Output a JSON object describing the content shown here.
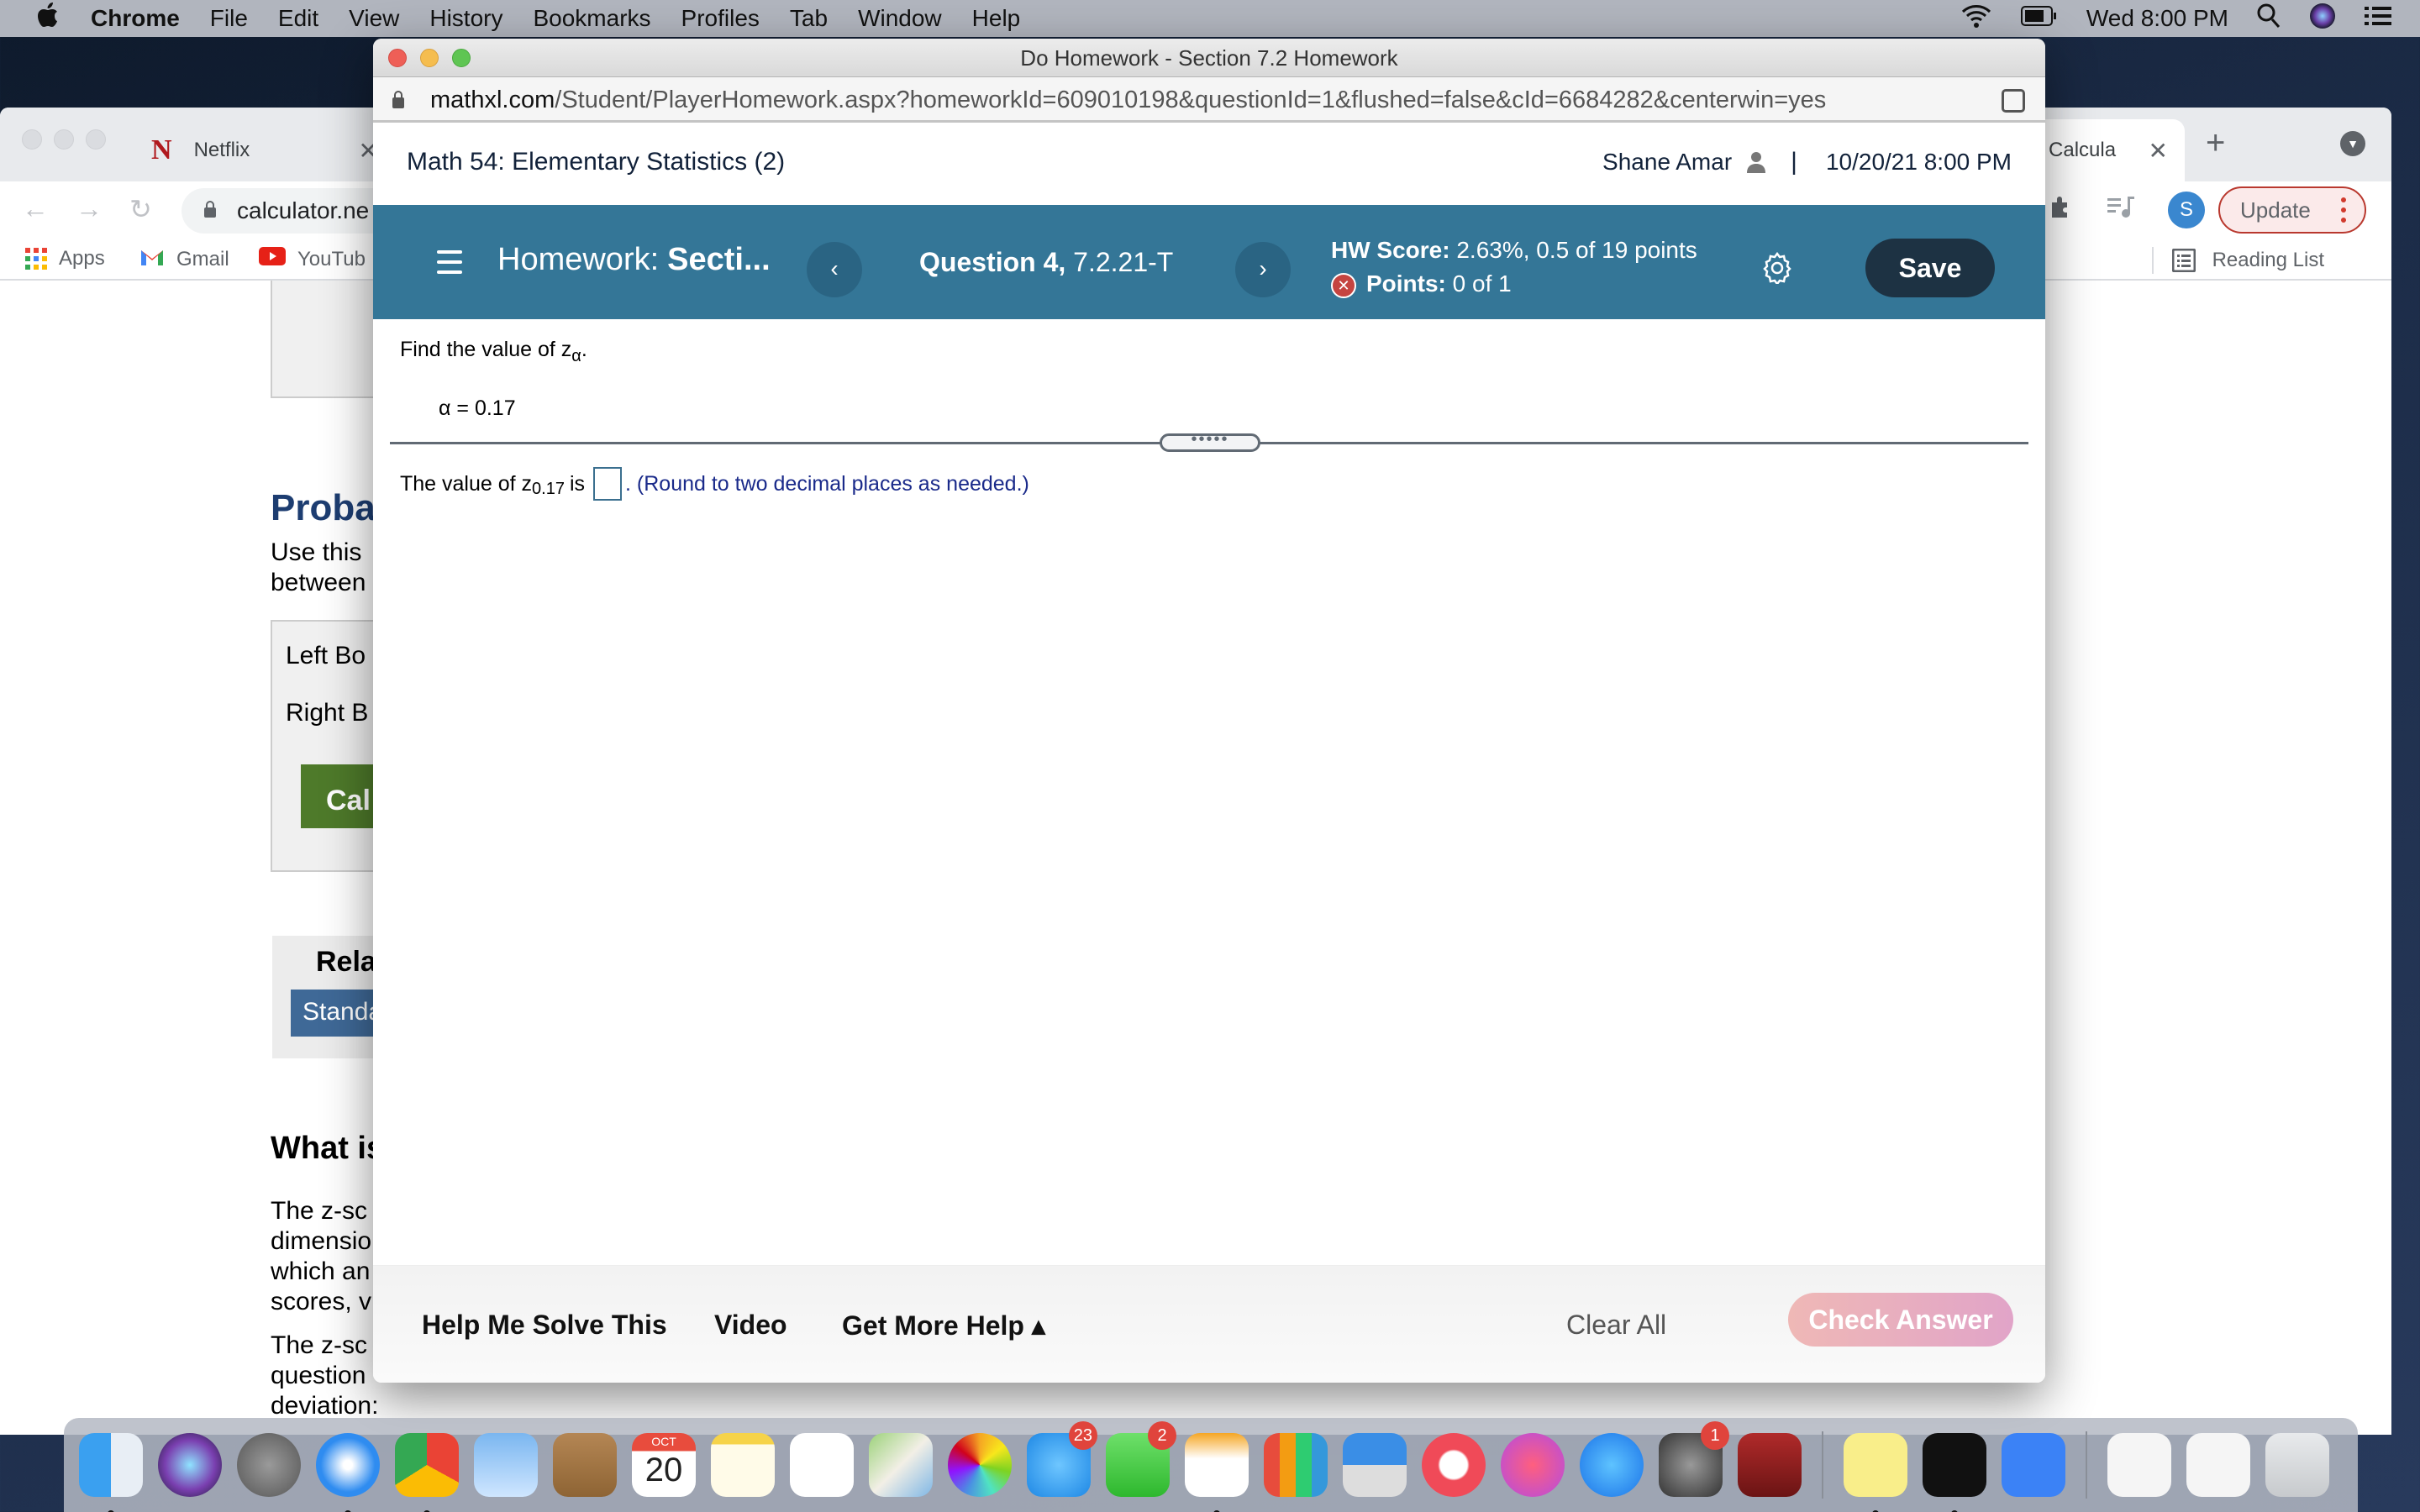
{
  "menubar": {
    "apple_icon": "apple-logo",
    "items": [
      "Chrome",
      "File",
      "Edit",
      "View",
      "History",
      "Bookmarks",
      "Profiles",
      "Tab",
      "Window",
      "Help"
    ],
    "clock": "Wed 8:00 PM",
    "status_icons": [
      "wifi-icon",
      "battery-icon",
      "spotlight-search-icon",
      "siri-icon",
      "control-center-icon"
    ]
  },
  "bg_browser": {
    "tabs": [
      {
        "label": "Netflix",
        "icon": "netflix-icon"
      },
      {
        "label": "re Calcula",
        "active": true
      }
    ],
    "new_tab_label": "+",
    "address": "calculator.ne",
    "avatar_letter": "S",
    "update_label": "Update",
    "bookmarks": [
      {
        "label": "Apps",
        "icon": "apps-grid-icon"
      },
      {
        "label": "Gmail",
        "icon": "gmail-icon"
      },
      {
        "label": "YouTub",
        "icon": "youtube-icon"
      }
    ],
    "reading_list": "Reading List",
    "page": {
      "heading_proba": "Proba",
      "use_this": [
        "Use this",
        "between"
      ],
      "left_bound": "Left Bo",
      "right_bound": "Right B",
      "calc_button": "Cal",
      "related": "Rela",
      "standard_link": "Standa",
      "what_is": "What is",
      "para1": [
        "The z-sc",
        "dimensio",
        "which an",
        "scores, v"
      ],
      "para2": [
        "The z-sc",
        "question",
        "deviation:"
      ]
    }
  },
  "popup": {
    "window_title": "Do Homework - Section 7.2 Homework",
    "url_domain": "mathxl.com",
    "url_path": "/Student/PlayerHomework.aspx?homeworkId=609010198&questionId=1&flushed=false&cId=6684282&centerwin=yes",
    "course_title": "Math 54: Elementary Statistics (2)",
    "user_name": "Shane Amar",
    "datetime": "10/20/21 8:00 PM",
    "hw_label": "Homework:",
    "hw_name": "Secti...",
    "prev_label": "‹",
    "next_label": "›",
    "question_label": "Question 4,",
    "question_id": "7.2.21-T",
    "hw_score_label": "HW Score:",
    "hw_score_value": "2.63%, 0.5 of 19 points",
    "points_label": "Points:",
    "points_value": "0 of 1",
    "save_label": "Save",
    "question": {
      "prompt_pre": "Find the value of z",
      "prompt_sub": "α",
      "prompt_post": ".",
      "alpha_line": "α = 0.17",
      "answer_pre": "The value of z",
      "answer_sub": "0.17",
      "answer_mid": " is",
      "answer_value": "",
      "hint": ". (Round to two decimal places as needed.)",
      "handle_dots": "•••••"
    },
    "footer": {
      "help_me_solve": "Help Me Solve This",
      "video": "Video",
      "get_more_help": "Get More Help ▴",
      "clear_all": "Clear All",
      "check_answer": "Check Answer"
    }
  },
  "dock": {
    "apps": [
      {
        "name": "finder",
        "running": true
      },
      {
        "name": "siri"
      },
      {
        "name": "launchpad"
      },
      {
        "name": "safari",
        "running": true
      },
      {
        "name": "chrome",
        "running": true
      },
      {
        "name": "mail"
      },
      {
        "name": "contacts"
      },
      {
        "name": "calendar",
        "month": "OCT",
        "day": "20"
      },
      {
        "name": "notes"
      },
      {
        "name": "reminders"
      },
      {
        "name": "maps"
      },
      {
        "name": "photos"
      },
      {
        "name": "messages",
        "badge": "23"
      },
      {
        "name": "facetime",
        "badge": "2"
      },
      {
        "name": "pages",
        "running": true
      },
      {
        "name": "numbers"
      },
      {
        "name": "keynote"
      },
      {
        "name": "news"
      },
      {
        "name": "music"
      },
      {
        "name": "app-store"
      },
      {
        "name": "system-preferences",
        "badge": "1"
      },
      {
        "name": "photo-booth"
      },
      {
        "name": "stickies",
        "running": true
      },
      {
        "name": "activity-monitor",
        "running": true
      },
      {
        "name": "zoom"
      },
      {
        "name": "chrome-window-1"
      },
      {
        "name": "chrome-window-2"
      },
      {
        "name": "trash"
      }
    ]
  },
  "colors": {
    "hw_bar": "#347697",
    "save_button": "#1d3243",
    "check_answer": "#e9aec0",
    "error_badge": "#c54440",
    "hint_text": "#1a2a8a",
    "update_border": "#b9382e"
  }
}
